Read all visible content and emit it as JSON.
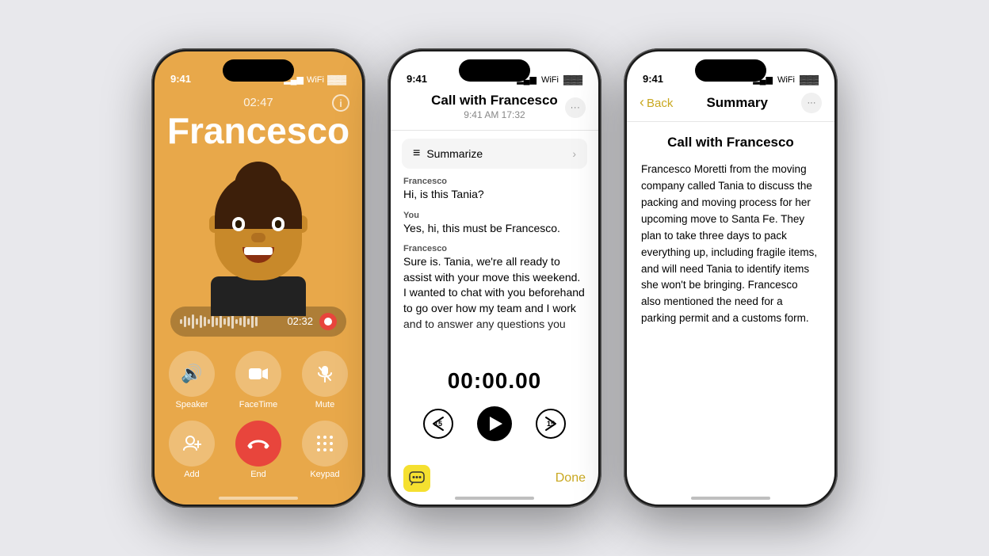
{
  "bg_color": "#e8e8ec",
  "phone1": {
    "status_time": "9:41",
    "call_duration": "02:47",
    "caller_name": "Francesco",
    "recording_time": "02:32",
    "info_label": "i",
    "buttons_row1": [
      {
        "id": "speaker",
        "icon": "🔊",
        "label": "Speaker"
      },
      {
        "id": "facetime",
        "icon": "📹",
        "label": "FaceTime"
      },
      {
        "id": "mute",
        "icon": "🎤",
        "label": "Mute"
      }
    ],
    "buttons_row2": [
      {
        "id": "add",
        "icon": "👤",
        "label": "Add"
      },
      {
        "id": "end",
        "icon": "📞",
        "label": "End"
      },
      {
        "id": "keypad",
        "icon": "⌨️",
        "label": "Keypad"
      }
    ]
  },
  "phone2": {
    "status_time": "9:41",
    "title": "Call with Francesco",
    "subtitle": "9:41 AM  17:32",
    "more_icon": "···",
    "summarize_label": "Summarize",
    "messages": [
      {
        "speaker": "Francesco",
        "text": "Hi, is this Tania?"
      },
      {
        "speaker": "You",
        "text": "Yes, hi, this must be Francesco."
      },
      {
        "speaker": "Francesco",
        "text": "Sure is. Tania, we're all ready to assist with your move this weekend. I wanted to chat with you beforehand to go over how my team and I work and to answer any questions you might have before we arrive Saturday"
      }
    ],
    "playback_time": "00:00.00",
    "skip_back_label": "15",
    "skip_forward_label": "15",
    "done_label": "Done"
  },
  "phone3": {
    "status_time": "9:41",
    "back_label": "Back",
    "nav_title": "Summary",
    "more_icon": "···",
    "call_title": "Call with Francesco",
    "summary_text": "Francesco Moretti from the moving company called Tania to discuss the packing and moving process for her upcoming move to Santa Fe. They plan to take three days to pack everything up, including fragile items, and will need Tania to identify items she won't be bringing. Francesco also mentioned the need for a parking permit and a customs form."
  }
}
